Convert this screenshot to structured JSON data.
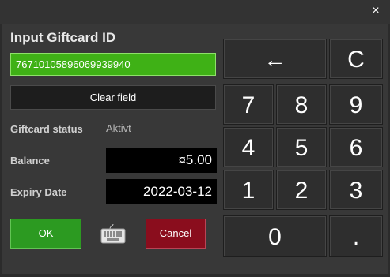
{
  "window": {
    "close_glyph": "×"
  },
  "form": {
    "heading": "Input Giftcard ID",
    "giftcard_id": "76710105896069939940",
    "clear_label": "Clear field",
    "status_label": "Giftcard status",
    "status_value": "Aktivt",
    "balance_label": "Balance",
    "balance_value": "¤5.00",
    "expiry_label": "Expiry Date",
    "expiry_value": "2022-03-12",
    "ok_label": "OK",
    "cancel_label": "Cancel",
    "keyboard_icon": "keyboard-icon"
  },
  "keypad": {
    "backspace": "←",
    "clear": "C",
    "k7": "7",
    "k8": "8",
    "k9": "9",
    "k4": "4",
    "k5": "5",
    "k6": "6",
    "k1": "1",
    "k2": "2",
    "k3": "3",
    "k0": "0",
    "dot": "."
  },
  "colors": {
    "input_active": "#3fb116",
    "ok": "#2c9a21",
    "cancel": "#8a0d1d"
  }
}
